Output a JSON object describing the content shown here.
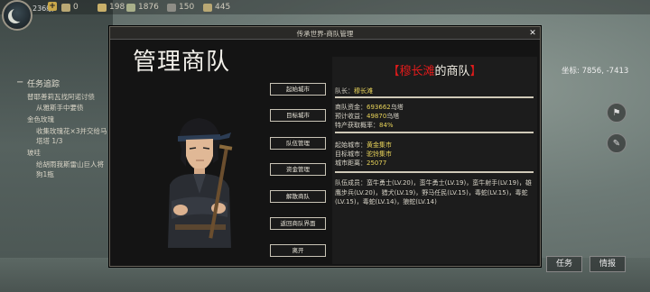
{
  "hud": {
    "level": "236级",
    "resources": [
      {
        "icon": "coin-icon",
        "value": "0"
      },
      {
        "icon": "silver-icon",
        "value": "198"
      },
      {
        "icon": "food-icon",
        "value": "1876"
      },
      {
        "icon": "ore-icon",
        "value": "150"
      },
      {
        "icon": "stone-icon",
        "value": "445"
      }
    ],
    "coords": "坐标: 7856, -7413"
  },
  "quest": {
    "header": "任务追踪",
    "lines": [
      "替耶善莉瓦找阿诺讨债",
      "从雅斯手中要债",
      "金色玫瑰",
      "收集玫瑰花×3并交给马",
      "塔塔 1/3",
      "玻哇",
      "给胡雨我斯雷山巨人将",
      "狗1瓶"
    ]
  },
  "dialog": {
    "title": "传承世界-商队管理",
    "close": "✕",
    "heading": "管理商队",
    "menu": [
      "起始城市",
      "目标城市",
      "队伍管理",
      "资金管理",
      "解散商队",
      "返回商队界面",
      "离开"
    ],
    "caravan": {
      "title_open": "【",
      "leader_name": "穆长滩",
      "title_suffix": "的商队",
      "title_close": "】",
      "leader_label": "队长：",
      "leader": "穆长滩",
      "funds_label": "商队资金：",
      "funds": "693662",
      "funds_unit": "乌塔",
      "profit_label": "预计收益：",
      "profit": "49870",
      "profit_unit": "乌塔",
      "special_label": "特产获取概率：",
      "special": "84%",
      "start_label": "起始城市：",
      "start": "黄金集市",
      "target_label": "目标城市：",
      "target": "驼铃集市",
      "distance_label": "城市距离：",
      "distance": "25077",
      "members_label": "队伍成员：",
      "members": "蛮牛勇士(LV.20)，蛮牛勇士(LV.19)，蛮牛射手(LV.19)，雄鹰步兵(LV.20)，猎犬(LV.19)，野马任民(LV.15)，毒蛇(LV.15)，毒蛇(LV.15)，毒蛇(LV.14)，狼蛇(LV.14)"
    }
  },
  "buttons": {
    "task": "任务",
    "intel": "情报"
  }
}
